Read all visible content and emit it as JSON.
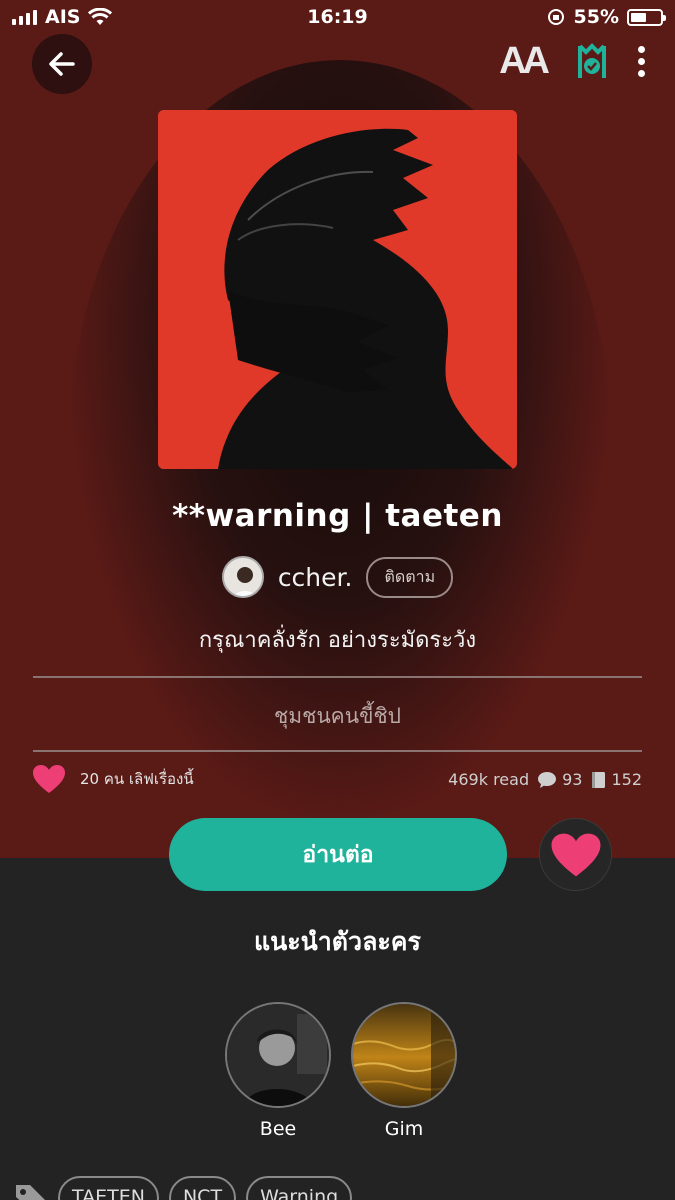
{
  "status_bar": {
    "carrier": "AIS",
    "time": "16:19",
    "battery": "55%",
    "battery_fraction": 0.55
  },
  "header": {
    "back_icon": "arrow-left-icon",
    "font_icon": "font-size-icon",
    "font_icon_text": "AA",
    "offline_icon": "offline-check-icon",
    "more_icon": "more-vertical-icon"
  },
  "story": {
    "title": "**warning | taeten",
    "author": "ccher.",
    "follow_label": "ติดตาม",
    "tagline": "กรุณาคลั่งรัก อย่างระมัดระวัง",
    "category": "ชุมชนคนขี้ชิป"
  },
  "stats": {
    "love_text": "20 คน เลิฟเรื่องนี้",
    "reads": "469k read",
    "comments": "93",
    "chapters": "152"
  },
  "actions": {
    "read_label": "อ่านต่อ"
  },
  "characters": {
    "section_title": "แนะนำตัวละคร",
    "items": [
      {
        "name": "Bee"
      },
      {
        "name": "Gim"
      }
    ]
  },
  "tags": [
    "TAETEN",
    "NCT",
    "Warning"
  ],
  "colors": {
    "hero_bg": "#5a1a16",
    "accent": "#1fb39c",
    "heart": "#ee3e76",
    "cover_red": "#e0392a",
    "panel_bg": "#232323"
  }
}
